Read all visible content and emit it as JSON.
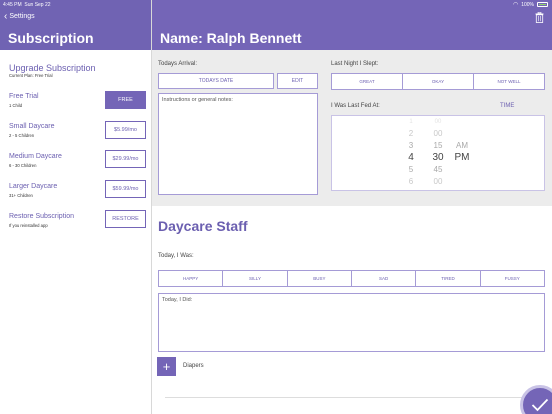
{
  "status_bar": {
    "time": "4:45 PM",
    "date": "Sun Sep 22",
    "battery": "100%"
  },
  "nav": {
    "back_label": "Settings"
  },
  "sidebar": {
    "title": "Subscription",
    "upgrade_title": "Upgrade Subscription",
    "current_plan": "Current Plan: Free Trial",
    "plans": [
      {
        "name": "Free Trial",
        "detail": "1 Child",
        "button": "FREE"
      },
      {
        "name": "Small Daycare",
        "detail": "2 - 5 Children",
        "button": "$5.99/mo"
      },
      {
        "name": "Medium Daycare",
        "detail": "6 - 30 Children",
        "button": "$29.99/mo"
      },
      {
        "name": "Larger Daycare",
        "detail": "31+ Children",
        "button": "$59.99/mo"
      },
      {
        "name": "Restore Subscription",
        "detail": "If you reinstalled app",
        "button": "RESTORE"
      }
    ]
  },
  "main": {
    "title": "Name: Ralph Bennett",
    "arrival": {
      "label": "Todays Arrival:",
      "date_button": "TODAYS DATE",
      "edit_button": "EDIT",
      "notes_placeholder": "Instructions or general notes:"
    },
    "sleep": {
      "label": "Last Night I Slept:",
      "options": [
        "GREAT",
        "OKAY",
        "NOT WELL"
      ]
    },
    "fed": {
      "label": "I Was Last Fed At:",
      "time_label": "TIME",
      "picker": {
        "hours": [
          "1",
          "2",
          "3",
          "4",
          "5",
          "6"
        ],
        "minutes": [
          "00",
          "00",
          "15",
          "30",
          "45",
          "00"
        ],
        "periods": [
          "",
          "",
          "AM",
          "PM",
          "",
          ""
        ],
        "selected": {
          "hour": "4",
          "minute": "30",
          "period": "PM"
        }
      }
    },
    "staff": {
      "title": "Daycare Staff",
      "mood_label": "Today, I Was:",
      "moods": [
        "HAPPY",
        "SILLY",
        "BUSY",
        "SAD",
        "TIRED",
        "FUSSY"
      ],
      "did_placeholder": "Today, I Did:",
      "add_label": "+",
      "diapers_label": "Diapers"
    }
  },
  "colors": {
    "accent": "#7465b7",
    "header_left": "#7063b3",
    "background": "#ececec",
    "battery": "#8ed36a"
  }
}
